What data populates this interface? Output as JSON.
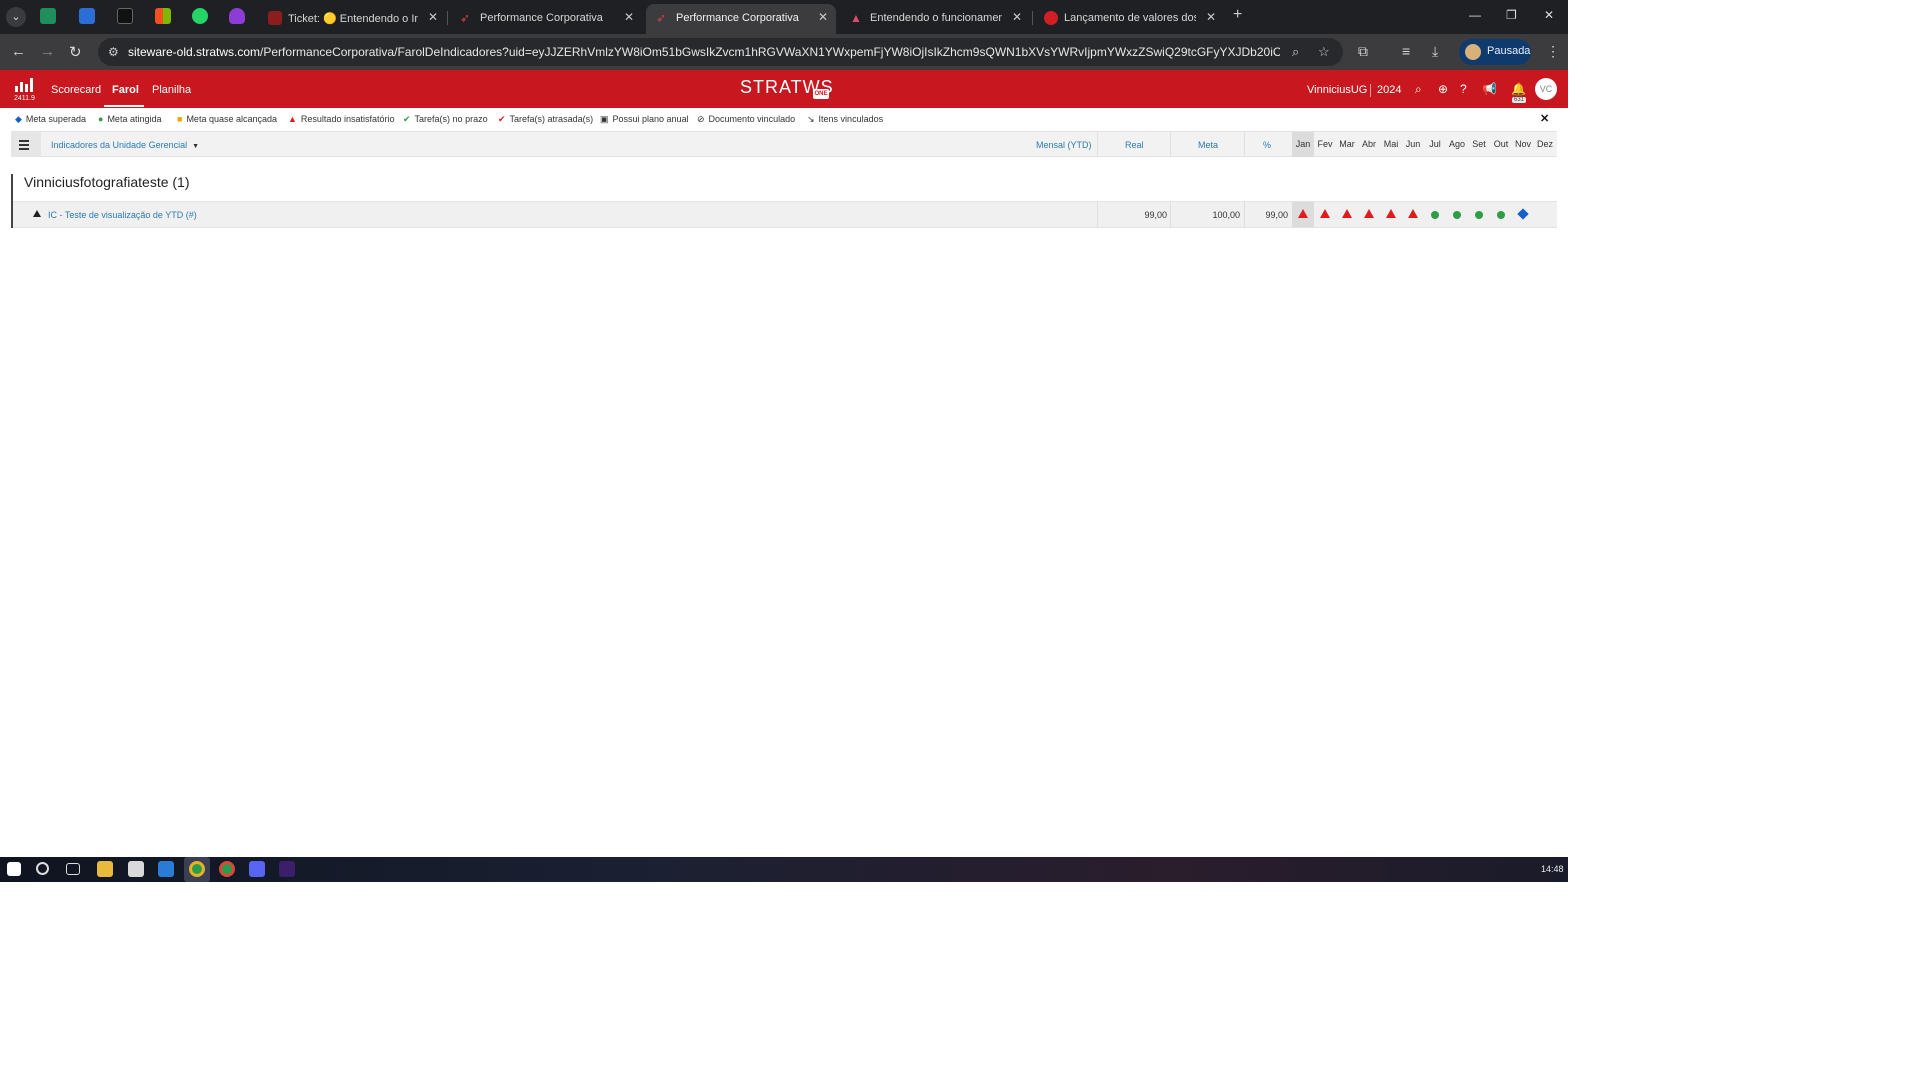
{
  "browser": {
    "tabs": [
      {
        "title": "Ticket: 🟡 Entendendo o Indica",
        "active": false
      },
      {
        "title": "Performance Corporativa",
        "active": false
      },
      {
        "title": "Performance Corporativa",
        "active": true
      },
      {
        "title": "Entendendo o funcionamento d",
        "active": false
      },
      {
        "title": "Lançamento de valores dos ind",
        "active": false
      }
    ],
    "url_host": "siteware-old.stratws.com",
    "url_path": "/PerformanceCorporativa/FarolDeIndicadores?uid=eyJJZERhVmlzYW8iOm51bGwsIkZvcm1hRGVWaXN1YWxpemFjYW8iOjIsIkZhcm9sQWN1bXVsYWRvIjpmYWxzZSwiQ29tcGFyYXJDb20iOjMsIkNvbXBhcmF...",
    "profile_label": "Pausada"
  },
  "app": {
    "version": "2411.9",
    "menu": [
      "Scorecard",
      "Farol",
      "Planilha"
    ],
    "active_menu": "Farol",
    "brand": "STRATWS",
    "brand_sub": "ONE",
    "user": "VinniciusUG",
    "year": "2024",
    "notifications": "631",
    "avatar_initials": "VC"
  },
  "legend": [
    {
      "label": "Meta superada",
      "icon": "blue-diamond"
    },
    {
      "label": "Meta atingida",
      "icon": "green-dot"
    },
    {
      "label": "Meta quase alcançada",
      "icon": "orange-square"
    },
    {
      "label": "Resultado insatisfatório",
      "icon": "red-triangle"
    },
    {
      "label": "Tarefa(s) no prazo",
      "icon": "green-check"
    },
    {
      "label": "Tarefa(s) atrasada(s)",
      "icon": "red-check"
    },
    {
      "label": "Possui plano anual",
      "icon": "plan-icon"
    },
    {
      "label": "Documento vinculado",
      "icon": "paperclip-icon"
    },
    {
      "label": "Itens vinculados",
      "icon": "link-icon"
    }
  ],
  "table": {
    "unit_selector": "Indicadores da Unidade Gerencial",
    "period_label": "Mensal (YTD)",
    "columns": [
      "Real",
      "Meta",
      "%"
    ],
    "months": [
      "Jan",
      "Fev",
      "Mar",
      "Abr",
      "Mai",
      "Jun",
      "Jul",
      "Ago",
      "Set",
      "Out",
      "Nov",
      "Dez"
    ],
    "current_month": "Jan"
  },
  "group": {
    "title": "Vinniciusfotografiateste (1)",
    "rows": [
      {
        "name": "IC - Teste de visualização de YTD (#)",
        "real": "99,00",
        "meta": "100,00",
        "pct": "99,00",
        "status": [
          "red-triangle",
          "red-triangle",
          "red-triangle",
          "red-triangle",
          "red-triangle",
          "red-triangle",
          "green-dot",
          "green-dot",
          "green-dot",
          "green-dot",
          "blue-diamond",
          ""
        ]
      }
    ]
  },
  "taskbar": {
    "clock": "14:48"
  },
  "colors": {
    "brand_red": "#c8171e",
    "link_blue": "#2a7bb5",
    "status_red": "#e01b1b",
    "status_green": "#2e9e46",
    "status_blue": "#1561c8"
  }
}
